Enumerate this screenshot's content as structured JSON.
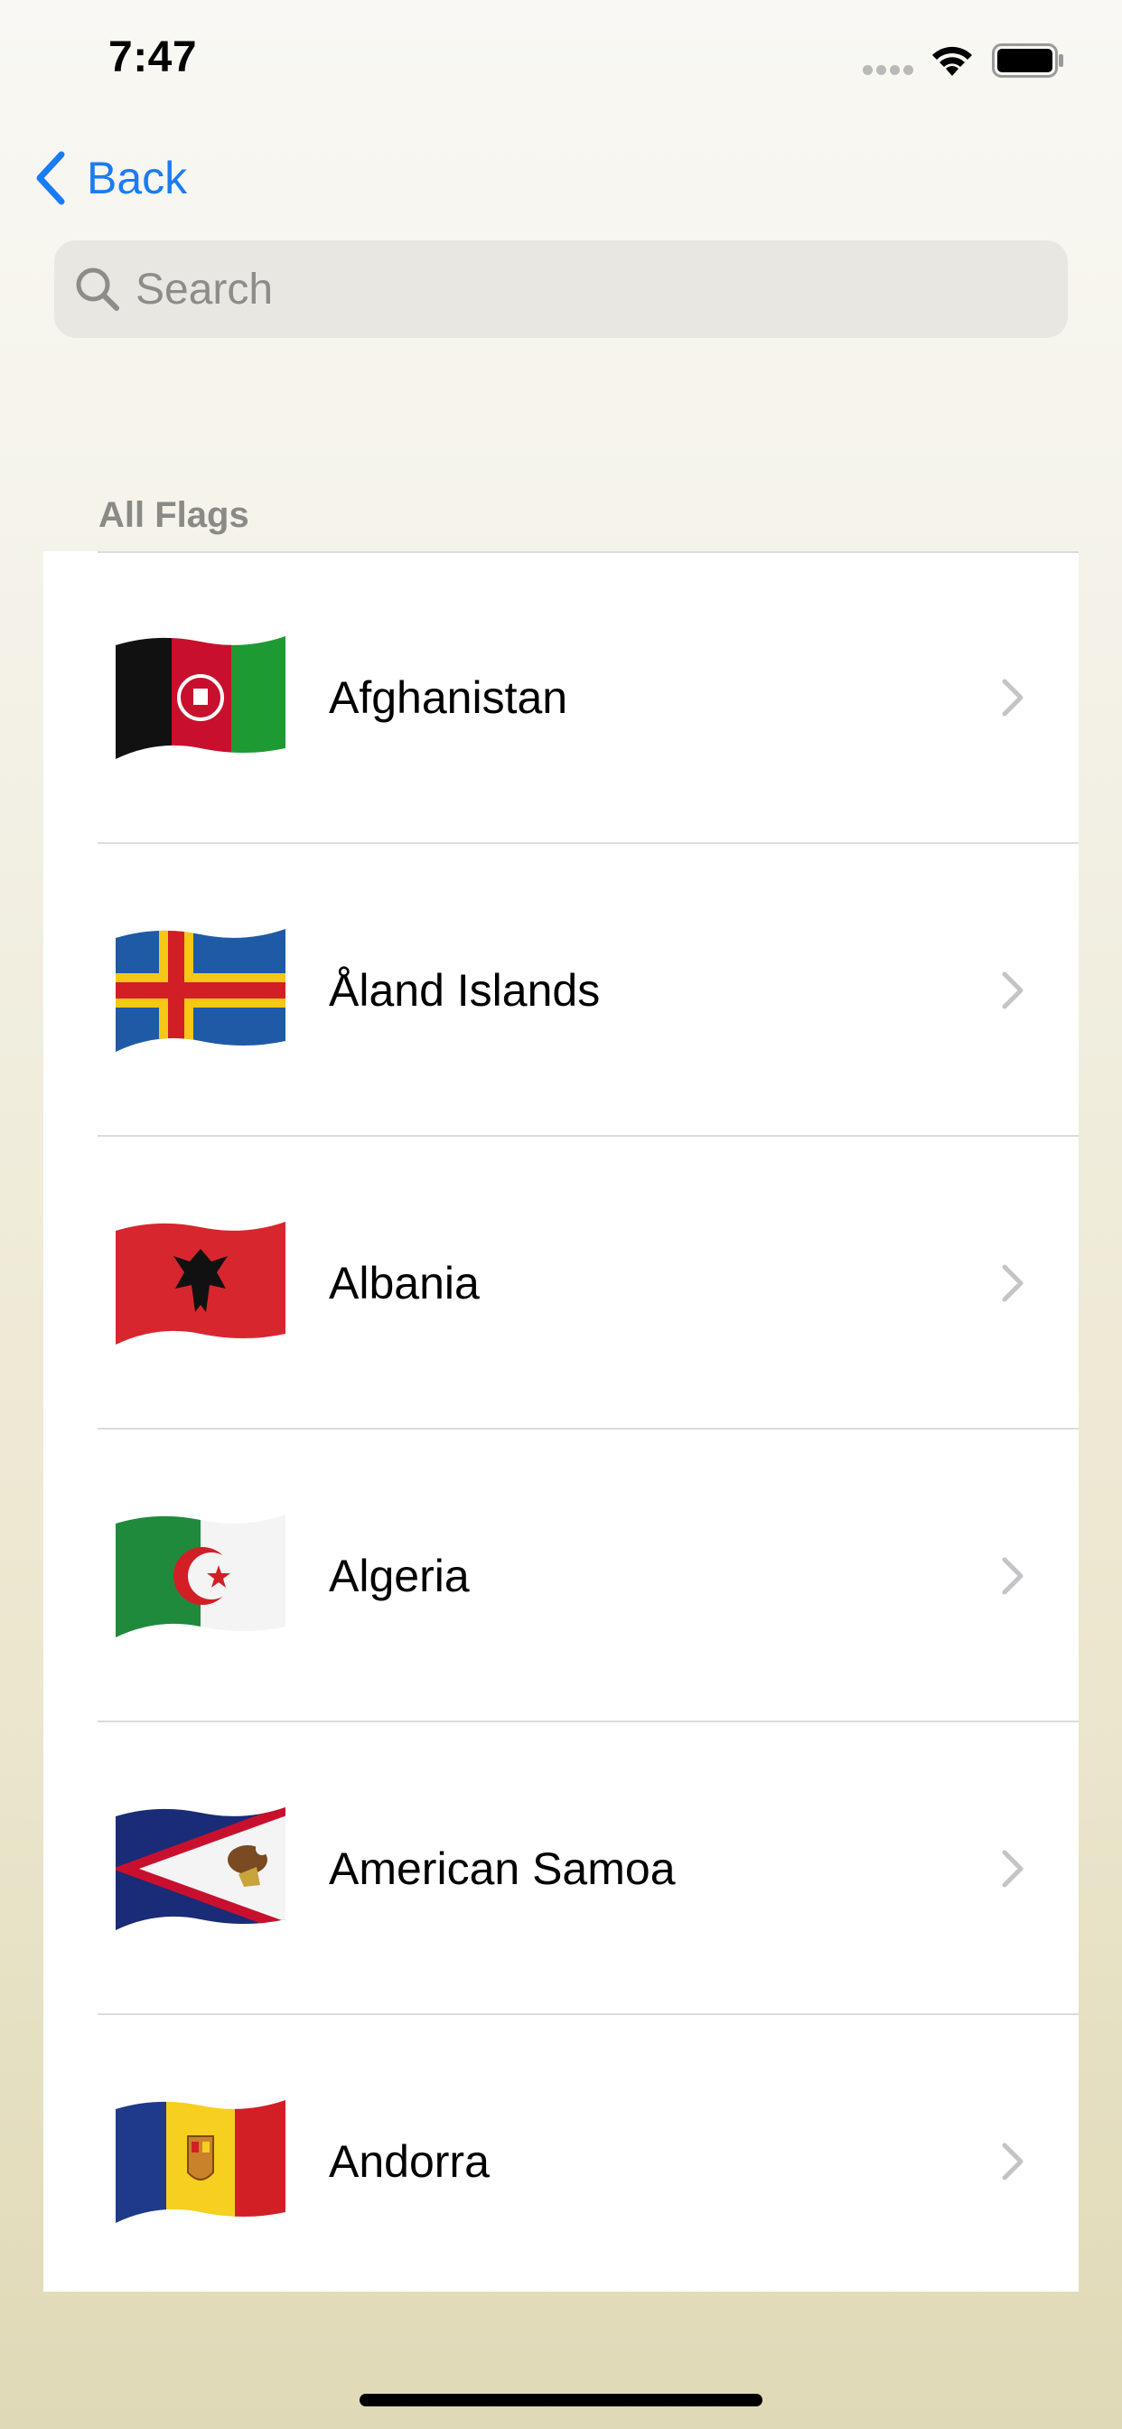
{
  "status_bar": {
    "time": "7:47"
  },
  "nav": {
    "back_label": "Back"
  },
  "search": {
    "placeholder": "Search",
    "value": ""
  },
  "section": {
    "title": "All Flags"
  },
  "countries": [
    {
      "name": "Afghanistan"
    },
    {
      "name": "Åland Islands"
    },
    {
      "name": "Albania"
    },
    {
      "name": "Algeria"
    },
    {
      "name": "American Samoa"
    },
    {
      "name": "Andorra"
    }
  ],
  "colors": {
    "accent": "#1a7cf5",
    "chevron": "#c4c4c7",
    "separator": "#dcdcdc"
  }
}
